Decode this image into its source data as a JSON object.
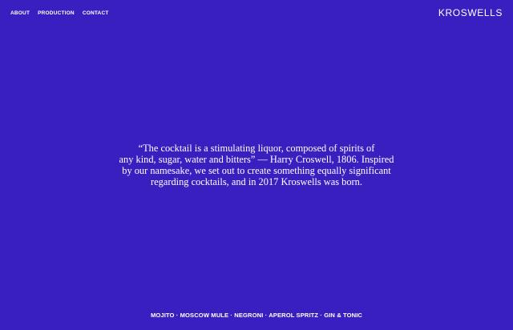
{
  "colors": {
    "background": "#3a1fc0",
    "text": "#ffffff"
  },
  "nav": {
    "items": [
      "ABOUT",
      "PRODUCTION",
      "CONTACT"
    ]
  },
  "logo": {
    "text": "KROSWELLS"
  },
  "quote": {
    "lines": [
      "“The cocktail is a stimulating liquor, composed of spirits of",
      "any kind, sugar, water and bitters” — Harry Croswell, 1806. Inspired",
      "by our namesake, we set out to create something equally significant",
      "regarding cocktails, and in 2017 Kroswells was born."
    ]
  },
  "footer": {
    "separator": "·",
    "cocktails": [
      "MOJITO",
      "MOSCOW MULE",
      "NEGRONI",
      "APEROL SPRITZ",
      "GIN & TONIC"
    ]
  }
}
